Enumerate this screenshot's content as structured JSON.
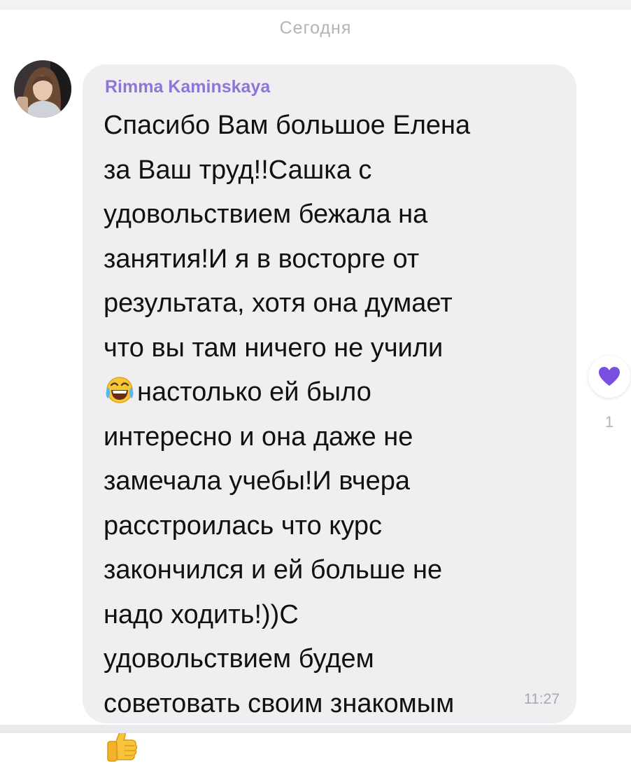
{
  "date_separator": "Сегодня",
  "message": {
    "sender": "Rimma Kaminskaya",
    "lines": [
      "Спасибо Вам большое Елена",
      "за Ваш труд!!Сашка с",
      "удовольствием  бежала на",
      "занятия!И я в восторге от",
      "результата, хотя она думает",
      "что вы там ничего не учили",
      "настолько ей было",
      "интересно и она даже не",
      "замечала учебы!И вчера",
      "расстроилась что курс",
      "закончился и ей больше не",
      "надо ходить!))С",
      "удовольствием будем",
      "советовать своим знакомым"
    ],
    "emojis": [
      "face-with-tears-of-joy",
      "thumbs-up"
    ],
    "time": "11:27"
  },
  "reaction": {
    "icon": "heart-icon",
    "count": "1",
    "color": "#7a4ee0"
  },
  "colors": {
    "bubble": "#efeff2",
    "sender_name": "#8f76d6",
    "text": "#111111",
    "muted": "#b3b3b8"
  }
}
